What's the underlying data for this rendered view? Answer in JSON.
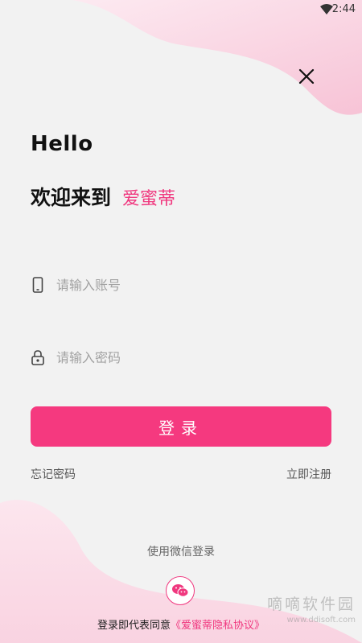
{
  "status_bar": {
    "time": "2:44"
  },
  "header": {
    "greeting": "Hello",
    "welcome": "欢迎来到",
    "brand": "爱蜜蒂"
  },
  "form": {
    "account_placeholder": "请输入账号",
    "password_placeholder": "请输入密码",
    "login_label": "登录",
    "forgot_label": "忘记密码",
    "register_label": "立即注册"
  },
  "social": {
    "wechat_label": "使用微信登录"
  },
  "agreement": {
    "prefix": "登录即代表同意",
    "link": "《爱蜜蒂隐私协议》"
  },
  "watermark": {
    "text": "嘀嘀软件园",
    "url": "www.ddisoft.com"
  },
  "colors": {
    "accent": "#f5397f",
    "background": "#f2f2f2",
    "pink_wave": "#f9d7e4"
  },
  "icons": [
    "wifi-icon",
    "close-icon",
    "phone-icon",
    "lock-icon",
    "wechat-icon"
  ]
}
